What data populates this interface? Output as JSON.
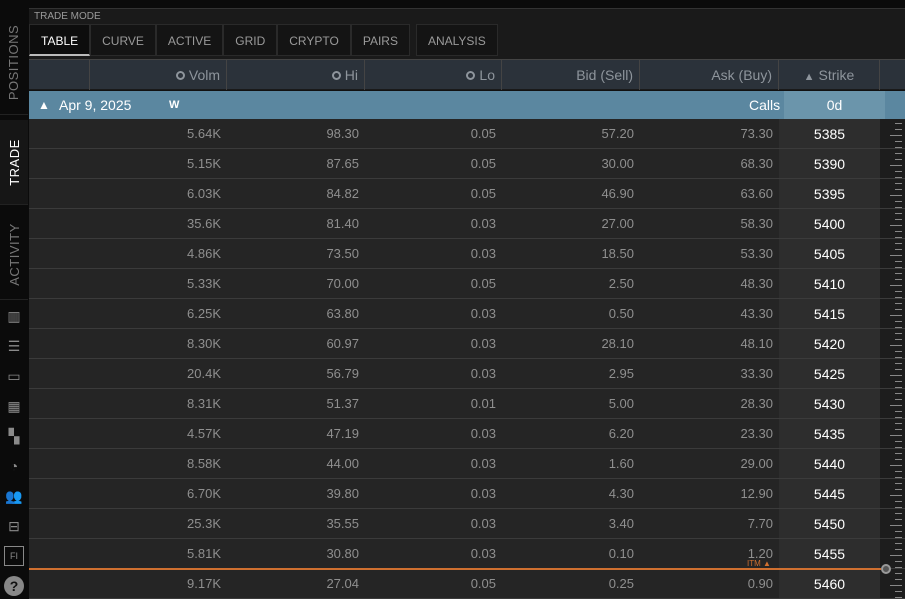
{
  "sidebar": {
    "tabs": [
      {
        "label": "POSITIONS"
      },
      {
        "label": "TRADE",
        "active": true
      },
      {
        "label": "ACTIVITY"
      }
    ],
    "icons": [
      "chart-book-icon",
      "list-icon",
      "tv-icon",
      "grid-chart-icon",
      "tiles-icon",
      "clock-refresh-icon",
      "people-icon",
      "calendar-return-icon",
      "fi-icon",
      "help-icon"
    ]
  },
  "trade_mode": {
    "label": "TRADE MODE",
    "tabs": [
      "TABLE",
      "CURVE",
      "ACTIVE",
      "GRID",
      "CRYPTO",
      "PAIRS",
      "ANALYSIS"
    ],
    "active": "TABLE"
  },
  "table": {
    "headers": [
      "",
      "Volm",
      "Hi",
      "Lo",
      "Bid (Sell)",
      "Ask (Buy)",
      "Strike"
    ],
    "group": {
      "date": "Apr 9, 2025",
      "weekly": "W",
      "side": "Calls",
      "dte": "0d"
    },
    "itm_label": "ITM",
    "rows": [
      [
        "5.64K",
        "98.30",
        "0.05",
        "57.20",
        "73.30",
        "5385"
      ],
      [
        "5.15K",
        "87.65",
        "0.05",
        "30.00",
        "68.30",
        "5390"
      ],
      [
        "6.03K",
        "84.82",
        "0.05",
        "46.90",
        "63.60",
        "5395"
      ],
      [
        "35.6K",
        "81.40",
        "0.03",
        "27.00",
        "58.30",
        "5400"
      ],
      [
        "4.86K",
        "73.50",
        "0.03",
        "18.50",
        "53.30",
        "5405"
      ],
      [
        "5.33K",
        "70.00",
        "0.05",
        "2.50",
        "48.30",
        "5410"
      ],
      [
        "6.25K",
        "63.80",
        "0.03",
        "0.50",
        "43.30",
        "5415"
      ],
      [
        "8.30K",
        "60.97",
        "0.03",
        "28.10",
        "48.10",
        "5420"
      ],
      [
        "20.4K",
        "56.79",
        "0.03",
        "2.95",
        "33.30",
        "5425"
      ],
      [
        "8.31K",
        "51.37",
        "0.01",
        "5.00",
        "28.30",
        "5430"
      ],
      [
        "4.57K",
        "47.19",
        "0.03",
        "6.20",
        "23.30",
        "5435"
      ],
      [
        "8.58K",
        "44.00",
        "0.03",
        "1.60",
        "29.00",
        "5440"
      ],
      [
        "6.70K",
        "39.80",
        "0.03",
        "4.30",
        "12.90",
        "5445"
      ],
      [
        "25.3K",
        "35.55",
        "0.03",
        "3.40",
        "7.70",
        "5450"
      ],
      [
        "5.81K",
        "30.80",
        "0.03",
        "0.10",
        "1.20",
        "5455"
      ],
      [
        "9.17K",
        "27.04",
        "0.05",
        "0.25",
        "0.90",
        "5460"
      ]
    ]
  },
  "colors": {
    "group_bg": "#5b87a0",
    "itm_line": "#d07030"
  }
}
